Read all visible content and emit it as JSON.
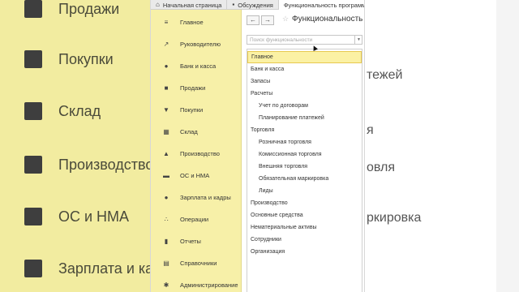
{
  "background": {
    "left_items": [
      "Продажи",
      "Покупки",
      "Склад",
      "Производство",
      "ОС и НМА",
      "Зарплата и ка"
    ],
    "right_fragments": [
      "тежей",
      "я",
      "овля",
      "ркировка"
    ]
  },
  "tabs": [
    {
      "label": "Начальная страница",
      "icon": "home-icon"
    },
    {
      "label": "Обсуждения",
      "icon": "chat-icon"
    },
    {
      "label": "Функциональность программы",
      "icon": ""
    }
  ],
  "sidebar": {
    "items": [
      {
        "label": "Главное",
        "icon": "menu-icon"
      },
      {
        "label": "Руководителю",
        "icon": "trend-icon"
      },
      {
        "label": "Банк и касса",
        "icon": "coin-icon"
      },
      {
        "label": "Продажи",
        "icon": "bag-icon"
      },
      {
        "label": "Покупки",
        "icon": "cart-icon"
      },
      {
        "label": "Склад",
        "icon": "warehouse-icon"
      },
      {
        "label": "Производство",
        "icon": "factory-icon"
      },
      {
        "label": "ОС и НМА",
        "icon": "truck-icon"
      },
      {
        "label": "Зарплата и кадры",
        "icon": "person-icon"
      },
      {
        "label": "Операции",
        "icon": "operations-icon"
      },
      {
        "label": "Отчеты",
        "icon": "chart-icon"
      },
      {
        "label": "Справочники",
        "icon": "book-icon"
      },
      {
        "label": "Администрирование",
        "icon": "gear-icon"
      }
    ]
  },
  "content": {
    "back_label": "←",
    "forward_label": "→",
    "star": "☆",
    "title": "Функциональность п",
    "search_placeholder": "Поиск функциональности",
    "dropdown_arrow": "▼"
  },
  "list": {
    "selected_index": 0,
    "items": [
      {
        "label": "Главное",
        "level": 0
      },
      {
        "label": "Банк и касса",
        "level": 0
      },
      {
        "label": "Запасы",
        "level": 0
      },
      {
        "label": "Расчеты",
        "level": 0
      },
      {
        "label": "Учет по договорам",
        "level": 1
      },
      {
        "label": "Планирование платежей",
        "level": 1
      },
      {
        "label": "Торговля",
        "level": 0
      },
      {
        "label": "Розничная торговля",
        "level": 1
      },
      {
        "label": "Комиссионная торговля",
        "level": 1
      },
      {
        "label": "Внешняя торговля",
        "level": 1
      },
      {
        "label": "Обязательная маркировка",
        "level": 1
      },
      {
        "label": "Лиды",
        "level": 1
      },
      {
        "label": "Производство",
        "level": 0
      },
      {
        "label": "Основные средства",
        "level": 0
      },
      {
        "label": "Нематериальные активы",
        "level": 0
      },
      {
        "label": "Сотрудники",
        "level": 0
      },
      {
        "label": "Организация",
        "level": 0
      }
    ]
  },
  "colors": {
    "sidebar_bg": "#f7f0a8",
    "selected_bg": "#fbf1a4",
    "selected_border": "#e7c94f"
  }
}
